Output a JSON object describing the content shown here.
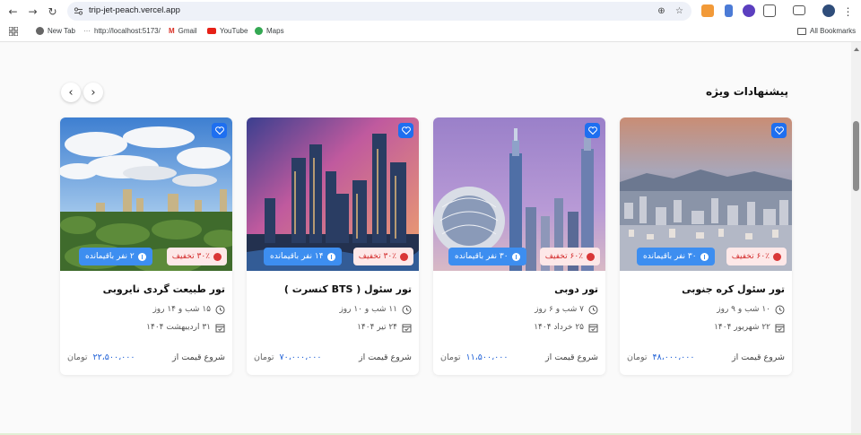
{
  "browser": {
    "url": "trip-jet-peach.vercel.app",
    "bookmarks": [
      "New Tab",
      "http://localhost:5173/",
      "Gmail",
      "YouTube",
      "Maps"
    ],
    "all_bookmarks": "All Bookmarks"
  },
  "section": {
    "title": "پیشنهادات ویژه",
    "prev_arrow": "‹",
    "next_arrow": "›"
  },
  "cards": [
    {
      "title": "تور سئول کره جنوبی",
      "discount": "۶۰٪ تخفیف",
      "seats": "۳۰ نفر باقیمانده",
      "duration": "۱۰ شب و ۹ روز",
      "date": "۲۲ شهریور ۱۴۰۴",
      "price_label": "شروع قیمت از",
      "price": "۴۸،۰۰۰،۰۰۰",
      "currency": "تومان"
    },
    {
      "title": "تور دوبی",
      "discount": "۶۰٪ تخفیف",
      "seats": "۳۰ نفر باقیمانده",
      "duration": "۷ شب و ۶ روز",
      "date": "۲۵ خرداد ۱۴۰۴",
      "price_label": "شروع قیمت از",
      "price": "۱۱،۵۰۰،۰۰۰",
      "currency": "تومان"
    },
    {
      "title": "تور سئول ( BTS کنسرت )",
      "discount": "۳۰٪ تخفیف",
      "seats": "۱۴ نفر باقیمانده",
      "duration": "۱۱ شب و ۱۰ روز",
      "date": "۲۴ تیر ۱۴۰۴",
      "price_label": "شروع قیمت از",
      "price": "۷۰،۰۰۰،۰۰۰",
      "currency": "تومان"
    },
    {
      "title": "تور طبیعت گردی نایروبی",
      "discount": "۳۰٪ تخفیف",
      "seats": "۲ نفر باقیمانده",
      "duration": "۱۵ شب و ۱۴ روز",
      "date": "۳۱ اردیبهشت ۱۴۰۴",
      "price_label": "شروع قیمت از",
      "price": "۲۲،۵۰۰،۰۰۰",
      "currency": "تومان"
    }
  ],
  "colors": {
    "accent": "#1e6ff0",
    "seat_badge": "#3d8ef0",
    "discount_bg": "#fde8e8",
    "discount_text": "#d32b2b",
    "price": "#1d5fd6"
  }
}
